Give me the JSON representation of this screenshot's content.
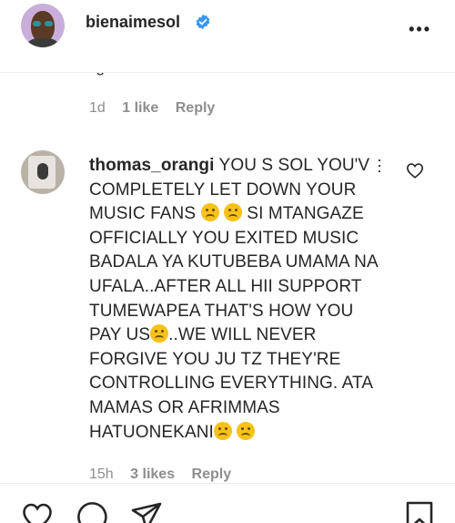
{
  "header": {
    "username": "bienaimesol",
    "more_icon": "more-horizontal-icon",
    "verified_icon": "verified-badge-icon"
  },
  "previous_comment": {
    "text_fragment": "light than the moon",
    "time": "1d",
    "likes": "1 like",
    "reply": "Reply"
  },
  "comment": {
    "username": "thomas_orangi",
    "text_parts": [
      "YOU S SOL YOU'V COMPLETELY LET DOWN YOUR MUSIC FANS ",
      "SI MTANGAZE OFFICIALLY YOU EXITED MUSIC BADALA YA KUTUBEBA UMAMA NA UFALA..AFTER ALL HII SUPPORT TUMEWAPEA THAT'S HOW YOU PAY US",
      "..WE WILL NEVER FORGIVE YOU JU TZ THEY'RE CONTROLLING EVERYTHING. ATA MAMAS OR AFRIMMAS HATUONEKANI"
    ],
    "emoji_name": "crying-face",
    "time": "15h",
    "likes": "3 likes",
    "reply": "Reply"
  },
  "actions": {
    "like_icon": "heart-icon",
    "comment_icon": "comment-icon",
    "share_icon": "paper-plane-icon",
    "save_icon": "bookmark-icon"
  },
  "colors": {
    "verified": "#3897f0",
    "meta_text": "#8e8e8e",
    "text": "#262626"
  }
}
